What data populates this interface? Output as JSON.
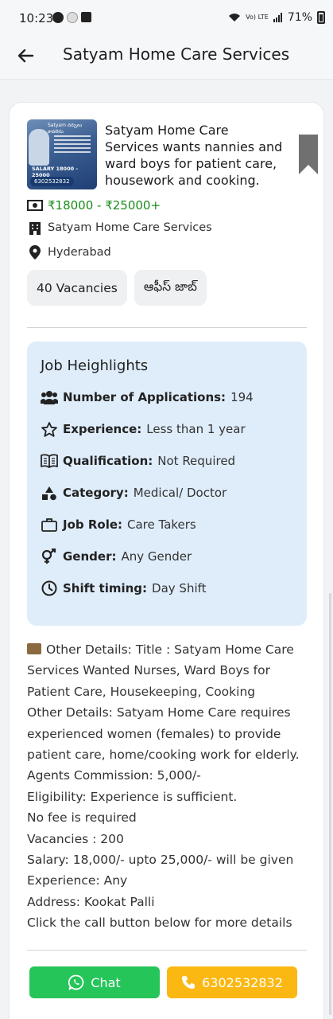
{
  "status_bar": {
    "time": "10:23",
    "volte": "Vo) LTE",
    "battery": "71%"
  },
  "app_bar": {
    "title": "Satyam Home Care Services"
  },
  "job": {
    "thumbnail": {
      "heading": "Satyam నర్సులు కావలెను",
      "salary": "SALARY 18000 - 25000",
      "phone": "6302532832"
    },
    "title": "Satyam Home Care Services wants nannies and ward boys for patient care, housework and cooking.",
    "salary": "₹18000 - ₹25000+",
    "company": "Satyam Home Care Services",
    "location": "Hyderabad",
    "tags": [
      "40 Vacancies",
      "ఆఫీస్ జాబ్"
    ]
  },
  "highlights": {
    "title": "Job Heighlights",
    "items": [
      {
        "icon": "users-icon",
        "label": "Number of Applications:",
        "value": "194"
      },
      {
        "icon": "star-icon",
        "label": "Experience:",
        "value": "Less than 1 year"
      },
      {
        "icon": "book-icon",
        "label": "Qualification:",
        "value": "Not Required"
      },
      {
        "icon": "shapes-icon",
        "label": "Category:",
        "value": "Medical/ Doctor"
      },
      {
        "icon": "briefcase-icon",
        "label": "Job Role:",
        "value": "Care Takers"
      },
      {
        "icon": "gender-icon",
        "label": "Gender:",
        "value": "Any Gender"
      },
      {
        "icon": "clock-icon",
        "label": "Shift timing:",
        "value": "Day Shift"
      }
    ]
  },
  "details": {
    "lines": [
      "Other Details: Title : Satyam Home Care Services Wanted Nurses, Ward Boys for Patient Care, Housekeeping, Cooking",
      "Other Details: Satyam Home Care requires experienced women (females) to provide patient care, home/cooking work for elderly.",
      "Agents Commission: 5,000/-",
      "Eligibility: Experience is sufficient.",
      "No fee is required",
      "Vacancies : 200",
      "Salary: 18,000/- upto 25,000/- will be given",
      "Experience: Any",
      "Address: Kookat Palli",
      "Click the call button below for more details"
    ]
  },
  "actions": {
    "chat_label": "Chat",
    "call_label": "6302532832"
  },
  "colors": {
    "salary_green": "#1a8c1a",
    "highlight_bg": "#dfedfb",
    "chat_green": "#25c55a",
    "call_yellow": "#fbb813",
    "bookmark_gray": "#707070"
  }
}
